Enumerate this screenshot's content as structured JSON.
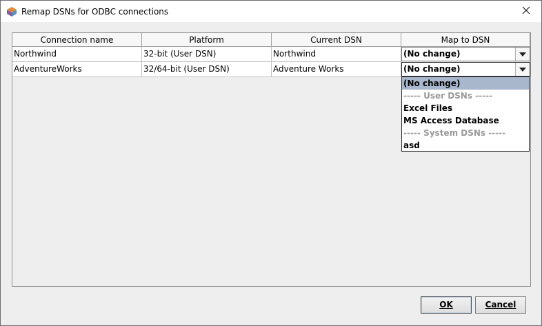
{
  "window": {
    "title": "Remap DSNs for ODBC connections",
    "close_symbol": "✕"
  },
  "table": {
    "columns": [
      "Connection name",
      "Platform",
      "Current DSN",
      "Map to DSN"
    ],
    "rows": [
      {
        "connection": "Northwind",
        "platform": "32-bit (User DSN)",
        "current_dsn": "Northwind",
        "map_to": "(No change)"
      },
      {
        "connection": "AdventureWorks",
        "platform": "32/64-bit (User DSN)",
        "current_dsn": "Adventure Works",
        "map_to": "(No change)"
      }
    ]
  },
  "dropdown": {
    "items": [
      {
        "label": "(No change)",
        "state": "selected"
      },
      {
        "label": "----- User DSNs -----",
        "state": "disabled"
      },
      {
        "label": "Excel Files",
        "state": "normal"
      },
      {
        "label": "MS Access Database",
        "state": "normal"
      },
      {
        "label": "----- System DSNs -----",
        "state": "disabled"
      },
      {
        "label": "asd",
        "state": "normal"
      }
    ]
  },
  "buttons": {
    "ok": "OK",
    "cancel": "Cancel"
  },
  "colors": {
    "selection": "#a8b7cc",
    "disabled_text": "#9a9a9a"
  }
}
